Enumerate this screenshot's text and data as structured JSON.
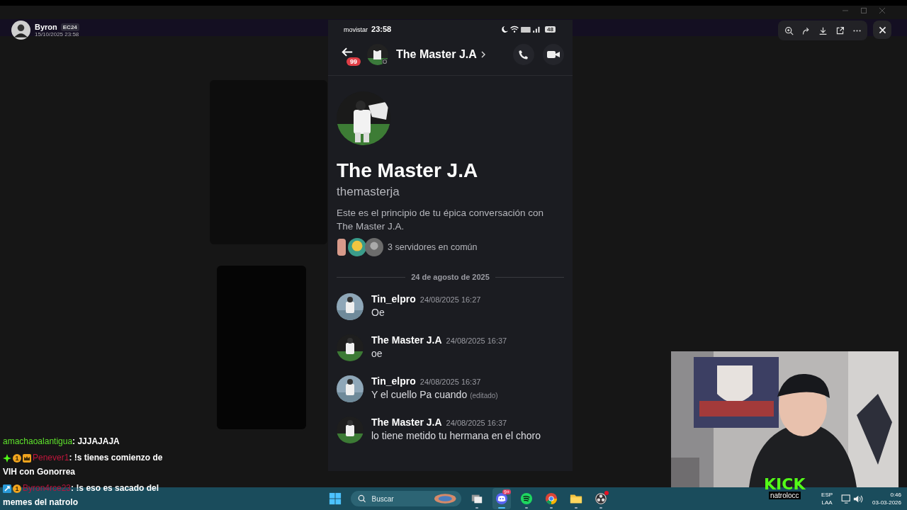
{
  "backdrop": {
    "author": {
      "name": "Byron",
      "tag": "EC24",
      "timestamp": "15/10/2025 23:58"
    }
  },
  "viewer_toolbar": {
    "buttons": [
      {
        "kind": "zoom"
      },
      {
        "kind": "forward"
      },
      {
        "kind": "download"
      },
      {
        "kind": "open"
      },
      {
        "kind": "more"
      }
    ]
  },
  "phone": {
    "status_bar": {
      "carrier": "movistar",
      "time": "23:58",
      "battery": "48"
    },
    "header": {
      "unread_badge": "99",
      "title": "The Master J.A"
    },
    "profile": {
      "display_name": "The Master J.A",
      "username": "themasterja",
      "intro": "Este es el principio de tu épica conversación con The Master J.A.",
      "mutual_servers": "3 servidores en común"
    },
    "date_divider": "24 de agosto de 2025",
    "messages": [
      {
        "author": "Tin_elpro",
        "timestamp": "24/08/2025 16:27",
        "text": "Oe"
      },
      {
        "author": "The Master J.A",
        "timestamp": "24/08/2025 16:37",
        "text": "oe"
      },
      {
        "author": "Tin_elpro",
        "timestamp": "24/08/2025 16:37",
        "text": "Y el cuello Pa cuando",
        "edited_label": "(editado)"
      },
      {
        "author": "The Master J.A",
        "timestamp": "24/08/2025 16:37",
        "text": "lo tiene metido tu hermana en el choro"
      }
    ]
  },
  "stream_chat": [
    {
      "username": "amachaoalantigua",
      "color": "#5ee12c",
      "text": ": JJJAJAJA"
    },
    {
      "username": "Penever1",
      "color": "#c0163c",
      "badges": [
        {
          "kind": "plus"
        },
        {
          "kind": "coin",
          "label": "1"
        },
        {
          "kind": "crown"
        }
      ],
      "text": ": !s tienes comienzo de VIH con Gonorrea"
    },
    {
      "username": "Byron4rce23",
      "color": "#b3153e",
      "badges": [
        {
          "kind": "tool"
        },
        {
          "kind": "coin",
          "label": "1"
        }
      ],
      "text": ": !s eso es sacado del memes del natrolo"
    }
  ],
  "webcam": {
    "brand": "KICK",
    "channel": "natrolocc"
  },
  "taskbar": {
    "search_placeholder": "Buscar",
    "apps": [
      {
        "kind": "taskview",
        "selected": false
      },
      {
        "kind": "discord",
        "badge": "9+",
        "selected": true
      },
      {
        "kind": "spotify",
        "selected": false
      },
      {
        "kind": "chrome",
        "selected": false
      },
      {
        "kind": "folder",
        "selected": false
      },
      {
        "kind": "obs",
        "selected": false,
        "alert": true
      }
    ],
    "language": "ESP",
    "layout": "LAA",
    "time": "0:46",
    "date": "03-03-2026"
  }
}
